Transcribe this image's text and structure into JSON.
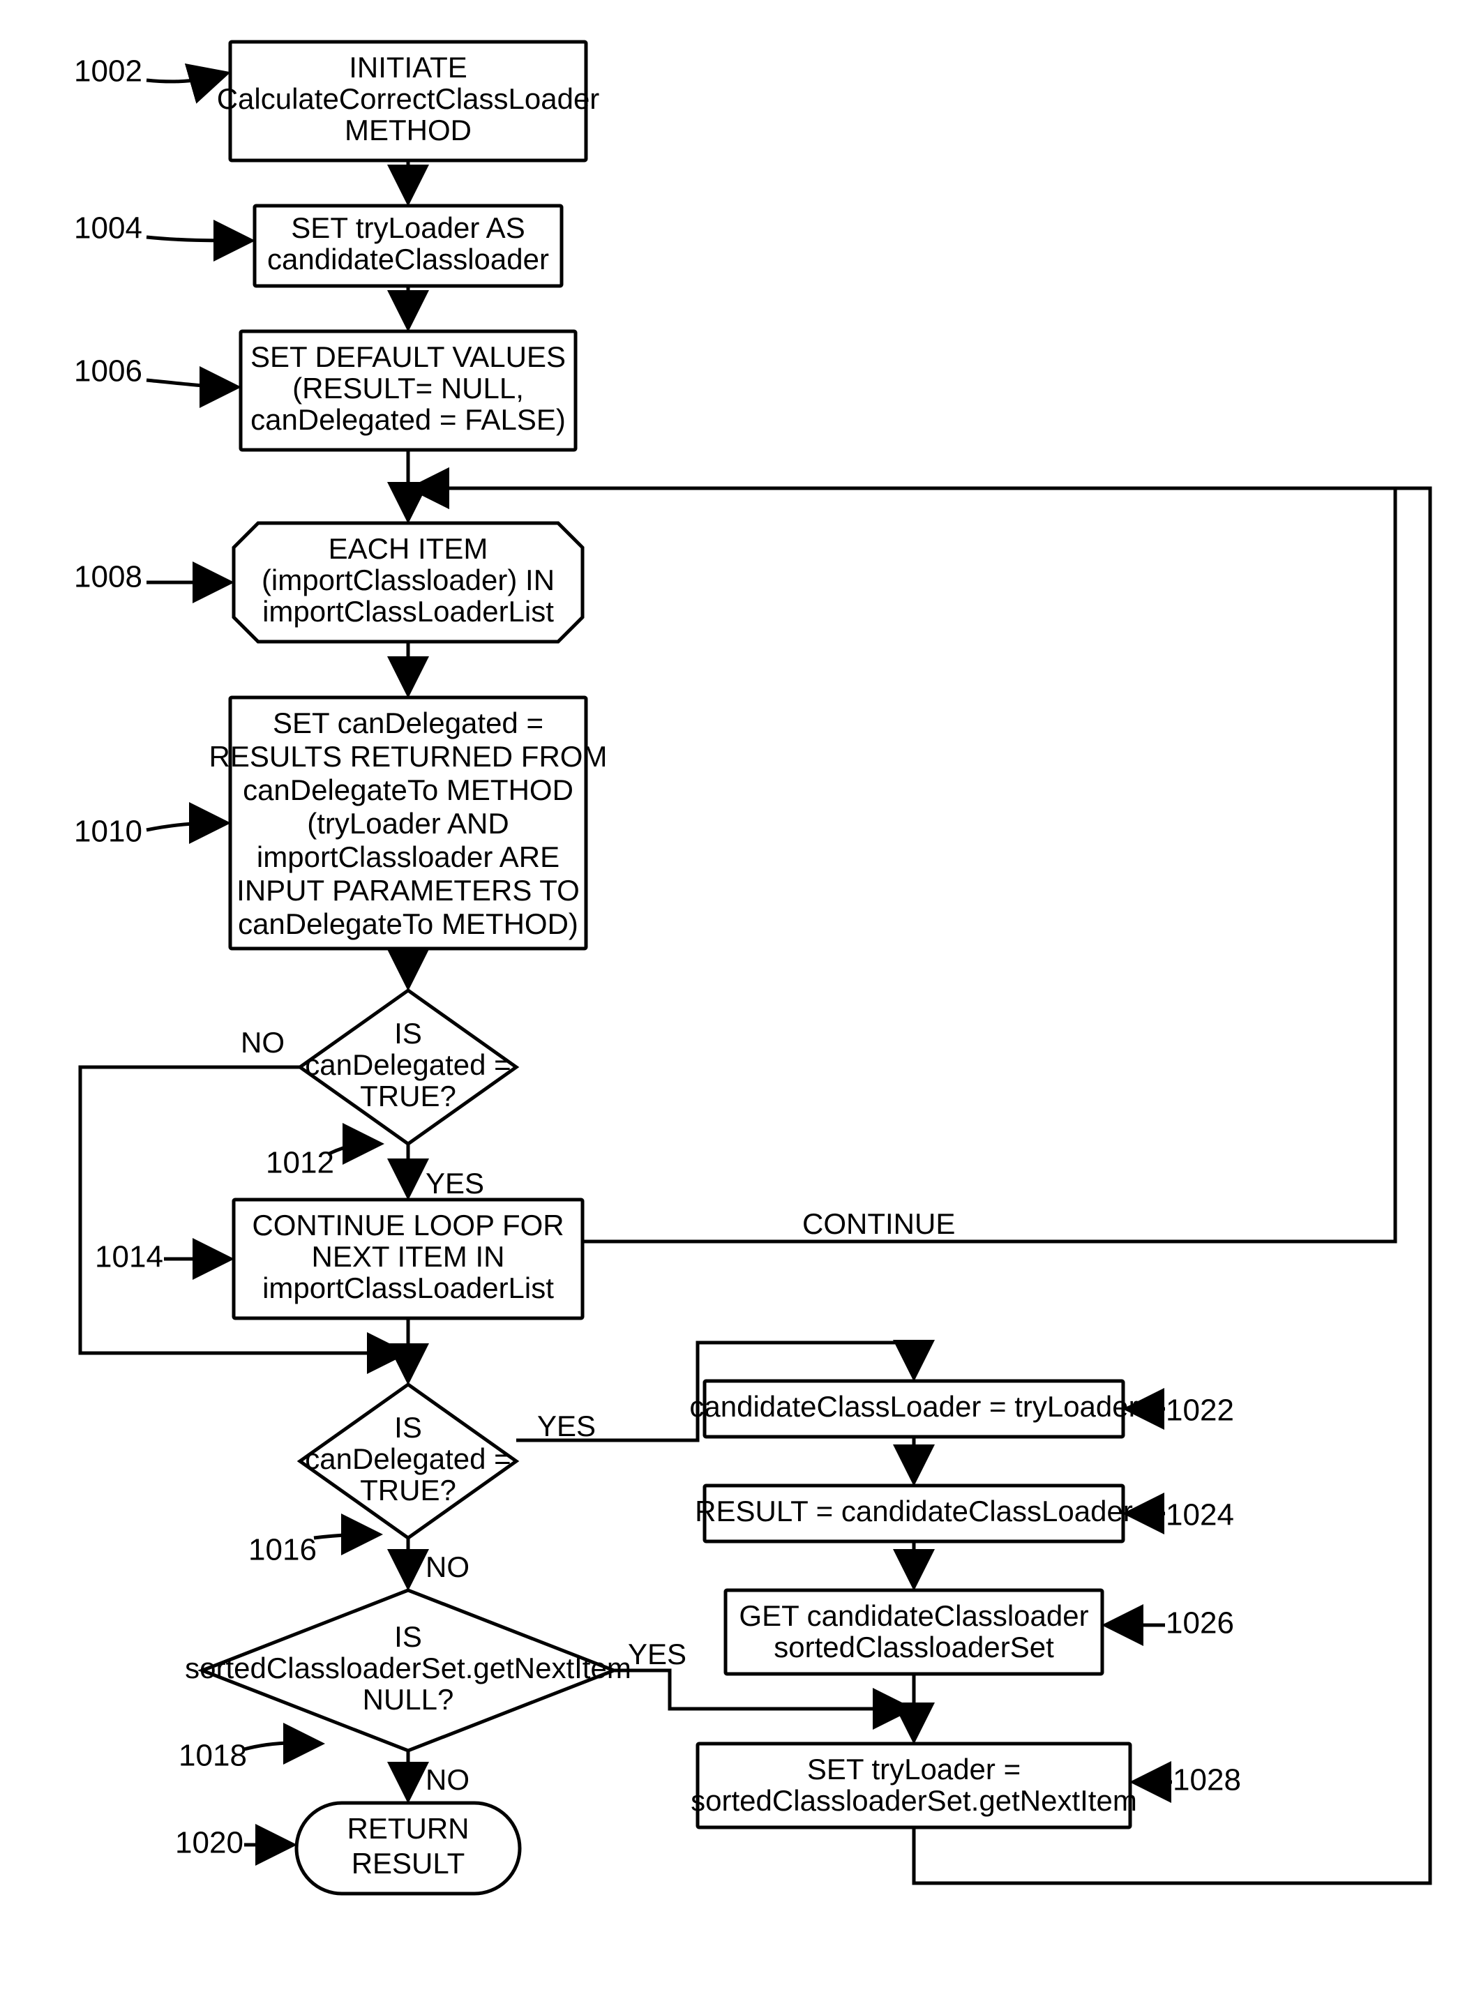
{
  "nodes": {
    "n1002": {
      "num": "1002",
      "l1": "INITIATE",
      "l2": "CalculateCorrectClassLoader",
      "l3": "METHOD"
    },
    "n1004": {
      "num": "1004",
      "l1": "SET tryLoader AS",
      "l2": "candidateClassloader"
    },
    "n1006": {
      "num": "1006",
      "l1": "SET DEFAULT VALUES",
      "l2": "(RESULT= NULL,",
      "l3": "canDelegated = FALSE)"
    },
    "n1008": {
      "num": "1008",
      "l1": "EACH ITEM",
      "l2": "(importClassloader) IN",
      "l3": "importClassLoaderList"
    },
    "n1010": {
      "num": "1010",
      "l1": "SET canDelegated =",
      "l2": "RESULTS RETURNED FROM",
      "l3": "canDelegateTo METHOD",
      "l4": "(tryLoader AND",
      "l5": "importClassloader ARE",
      "l6": "INPUT PARAMETERS TO",
      "l7": "canDelegateTo METHOD)"
    },
    "n1012": {
      "num": "1012",
      "l1": "IS",
      "l2": "canDelegated =",
      "l3": "TRUE?"
    },
    "n1014": {
      "num": "1014",
      "l1": "CONTINUE LOOP FOR",
      "l2": "NEXT ITEM IN",
      "l3": "importClassLoaderList"
    },
    "n1016": {
      "num": "1016",
      "l1": "IS",
      "l2": "canDelegated =",
      "l3": "TRUE?"
    },
    "n1018": {
      "num": "1018",
      "l1": "IS",
      "l2": "sortedClassloaderSet.getNextItem",
      "l3": "NULL?"
    },
    "n1020": {
      "num": "1020",
      "l1": "RETURN",
      "l2": "RESULT"
    },
    "n1022": {
      "num": "1022",
      "l1": "candidateClassLoader = tryLoader"
    },
    "n1024": {
      "num": "1024",
      "l1": "RESULT = candidateClassLoader"
    },
    "n1026": {
      "num": "1026",
      "l1": "GET candidateClassloader",
      "l2": "sortedClassloaderSet"
    },
    "n1028": {
      "num": "1028",
      "l1": "SET tryLoader =",
      "l2": "sortedClassloaderSet.getNextItem"
    }
  },
  "edges": {
    "no": "NO",
    "yes": "YES",
    "continue": "CONTINUE"
  }
}
